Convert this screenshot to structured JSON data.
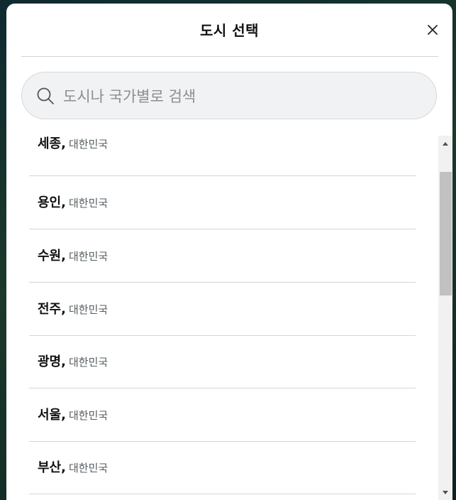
{
  "dialog": {
    "title": "도시 선택"
  },
  "search": {
    "placeholder": "도시나 국가별로 검색",
    "value": ""
  },
  "cities": [
    {
      "name": "세종,",
      "country": "대한민국"
    },
    {
      "name": "용인,",
      "country": "대한민국"
    },
    {
      "name": "수원,",
      "country": "대한민국"
    },
    {
      "name": "전주,",
      "country": "대한민국"
    },
    {
      "name": "광명,",
      "country": "대한민국"
    },
    {
      "name": "서울,",
      "country": "대한민국"
    },
    {
      "name": "부산,",
      "country": "대한민국"
    }
  ],
  "icons": {
    "close": "close-icon",
    "search": "search-icon",
    "scroll_up": "chevron-up-icon",
    "scroll_down": "chevron-down-icon"
  }
}
